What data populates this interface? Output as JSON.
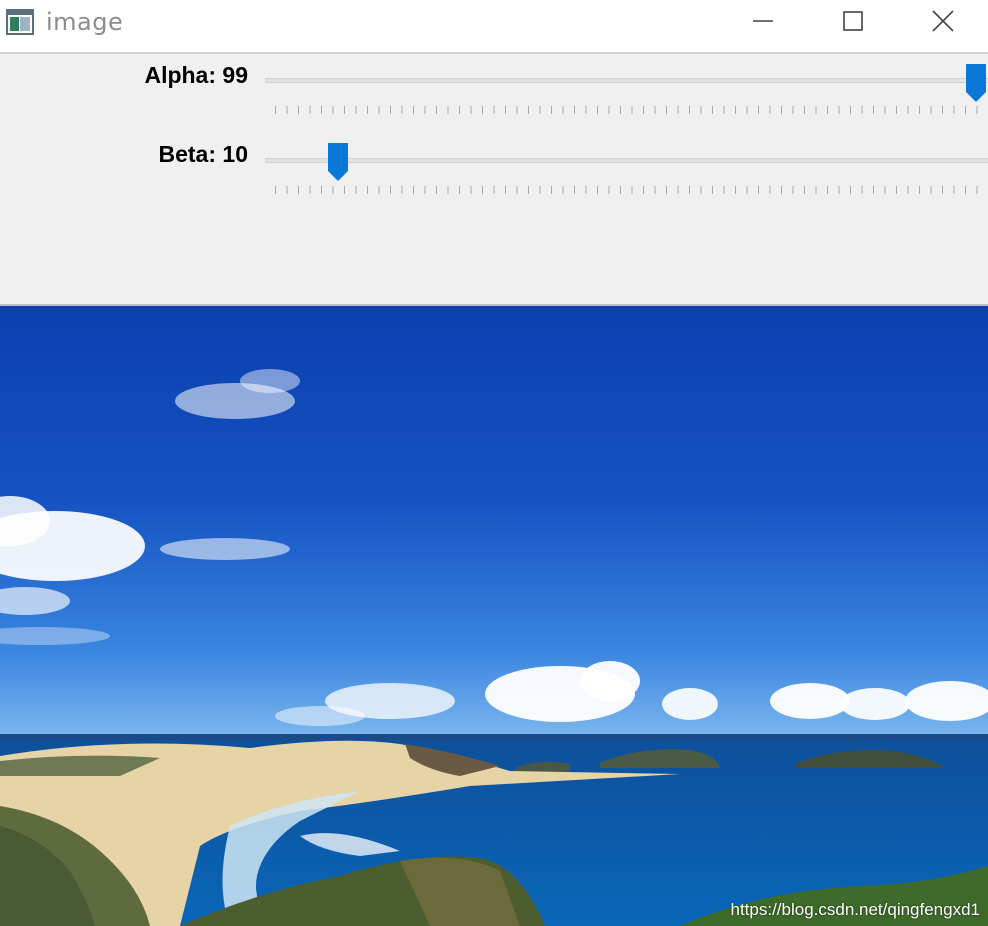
{
  "window": {
    "title": "image",
    "title_icon": "app-window-icon",
    "controls": [
      "minimize-icon",
      "maximize-icon",
      "close-icon"
    ]
  },
  "trackbars": [
    {
      "name": "Alpha",
      "separator": ": ",
      "value": "99",
      "max": 100
    },
    {
      "name": "Beta",
      "separator": ": ",
      "value": "10",
      "max": 100
    }
  ],
  "image": {
    "watermark": "https://blog.csdn.net/qingfengxd1"
  },
  "colors": {
    "thumb": "#0a78d7",
    "sky_top": "#0b3fae",
    "sea": "#0a5fae"
  }
}
